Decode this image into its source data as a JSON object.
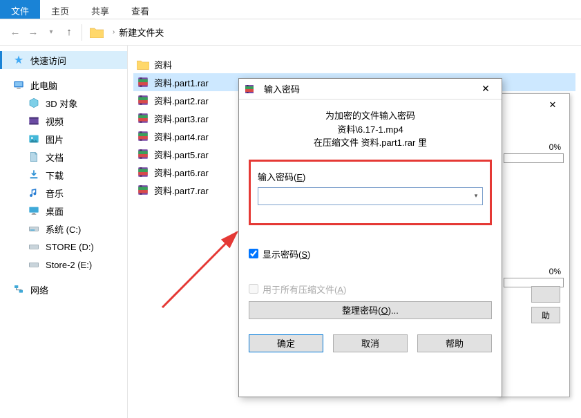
{
  "ribbon": {
    "file": "文件",
    "home": "主页",
    "share": "共享",
    "view": "查看"
  },
  "breadcrumb": {
    "folder": "新建文件夹"
  },
  "sidebar": {
    "quick": "快速访问",
    "pc": "此电脑",
    "pc_children": [
      "3D 对象",
      "视频",
      "图片",
      "文档",
      "下载",
      "音乐",
      "桌面",
      "系统 (C:)",
      "STORE (D:)",
      "Store-2 (E:)"
    ],
    "network": "网络"
  },
  "files": {
    "folder": "资料",
    "items": [
      "资料.part1.rar",
      "资料.part2.rar",
      "资料.part3.rar",
      "资料.part4.rar",
      "资料.part5.rar",
      "资料.part6.rar",
      "资料.part7.rar"
    ]
  },
  "bg": {
    "pct": "0%",
    "help": "助"
  },
  "pw": {
    "title": "输入密码",
    "line1": "为加密的文件输入密码",
    "line2": "资料\\6.17-1.mp4",
    "line3": "在压缩文件 资料.part1.rar 里",
    "label_pre": "输入密码(",
    "label_u": "E",
    "label_post": ")",
    "show_pre": "显示密码(",
    "show_u": "S",
    "show_post": ")",
    "all_pre": "用于所有压缩文件(",
    "all_u": "A",
    "all_post": ")",
    "org_pre": "整理密码(",
    "org_u": "O",
    "org_post": ")...",
    "ok": "确定",
    "cancel": "取消",
    "help": "帮助"
  }
}
